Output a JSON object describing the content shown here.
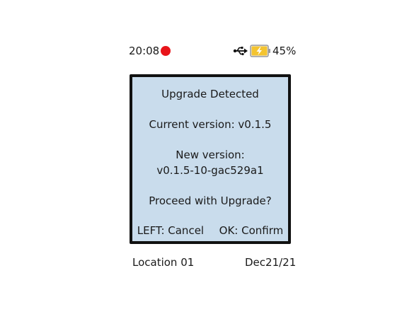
{
  "status_bar": {
    "time": "20:08",
    "recording_indicator": "red-dot",
    "usb_icon": "usb-icon",
    "battery_icon": "battery-charging-icon",
    "battery_percent": "45%",
    "battery_level": 0.45,
    "colors": {
      "record": "#e8141a",
      "battery_fill": "#f4c430"
    }
  },
  "dialog": {
    "title": "Upgrade Detected",
    "current_version": "Current version: v0.1.5",
    "new_version_label": "New version:",
    "new_version_value": "v0.1.5-10-gac529a1",
    "prompt": "Proceed with Upgrade?",
    "cancel_action": "LEFT: Cancel",
    "confirm_action": "OK: Confirm",
    "background": "#c9dcec"
  },
  "footer": {
    "location": "Location 01",
    "date": "Dec21/21"
  }
}
